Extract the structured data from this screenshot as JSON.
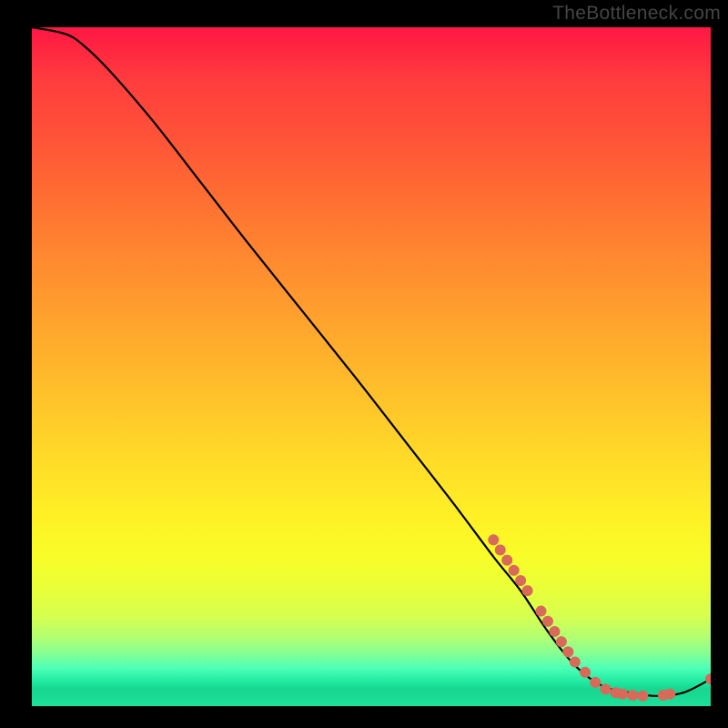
{
  "attribution": "TheBottleneck.com",
  "chart_data": {
    "type": "line",
    "title": "",
    "xlabel": "",
    "ylabel": "",
    "xlim": [
      0,
      100
    ],
    "ylim": [
      0,
      100
    ],
    "grid": false,
    "legend": false,
    "curve": {
      "name": "bottleneck-curve",
      "x": [
        0,
        5,
        8,
        12,
        18,
        25,
        32,
        40,
        48,
        55,
        62,
        68,
        72,
        76,
        80,
        84,
        88,
        92,
        96,
        100
      ],
      "y": [
        100,
        99,
        97,
        93,
        86,
        77,
        68,
        58,
        48,
        39,
        30,
        22,
        17,
        11,
        6,
        3,
        2,
        1.5,
        2,
        4
      ]
    },
    "markers": {
      "name": "highlight-dots",
      "color": "#d96a5a",
      "points": [
        {
          "x": 68,
          "y": 24.5
        },
        {
          "x": 69,
          "y": 23
        },
        {
          "x": 70,
          "y": 21.5
        },
        {
          "x": 71,
          "y": 20
        },
        {
          "x": 72,
          "y": 18.5
        },
        {
          "x": 73,
          "y": 17
        },
        {
          "x": 75,
          "y": 14
        },
        {
          "x": 76,
          "y": 12.5
        },
        {
          "x": 77,
          "y": 11
        },
        {
          "x": 78,
          "y": 9.5
        },
        {
          "x": 79,
          "y": 8
        },
        {
          "x": 80,
          "y": 6.5
        },
        {
          "x": 81.5,
          "y": 5
        },
        {
          "x": 83,
          "y": 3.5
        },
        {
          "x": 84.5,
          "y": 2.5
        },
        {
          "x": 86,
          "y": 2
        },
        {
          "x": 87,
          "y": 1.8
        },
        {
          "x": 88.5,
          "y": 1.6
        },
        {
          "x": 90,
          "y": 1.5
        },
        {
          "x": 93,
          "y": 1.6
        },
        {
          "x": 94,
          "y": 1.8
        },
        {
          "x": 100,
          "y": 4
        }
      ]
    }
  }
}
